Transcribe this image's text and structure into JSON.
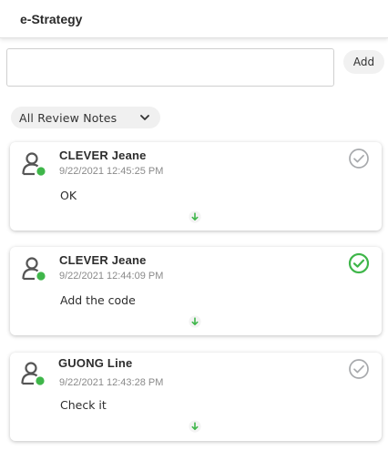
{
  "header": {
    "title": "e-Strategy"
  },
  "composer": {
    "placeholder": "",
    "value": "",
    "add_label": "Add"
  },
  "filter": {
    "label": "All Review Notes"
  },
  "colors": {
    "online": "#3fb64a",
    "done": "#3fb64a",
    "pending": "#a7a9ac",
    "expand": "#3fb64a"
  },
  "notes": [
    {
      "author": "CLEVER Jeane",
      "timestamp": "9/22/2021 12:45:25 PM",
      "text": "OK",
      "status": "pending",
      "status_icon": "check-circle-outline-icon"
    },
    {
      "author": "CLEVER Jeane",
      "timestamp": "9/22/2021 12:44:09 PM",
      "text": "Add the code",
      "status": "done",
      "status_icon": "check-circle-outline-icon"
    },
    {
      "author": "GUONG Line",
      "timestamp": "9/22/2021 12:43:28 PM",
      "text": "Check it",
      "status": "pending",
      "status_icon": "check-circle-outline-icon"
    }
  ]
}
